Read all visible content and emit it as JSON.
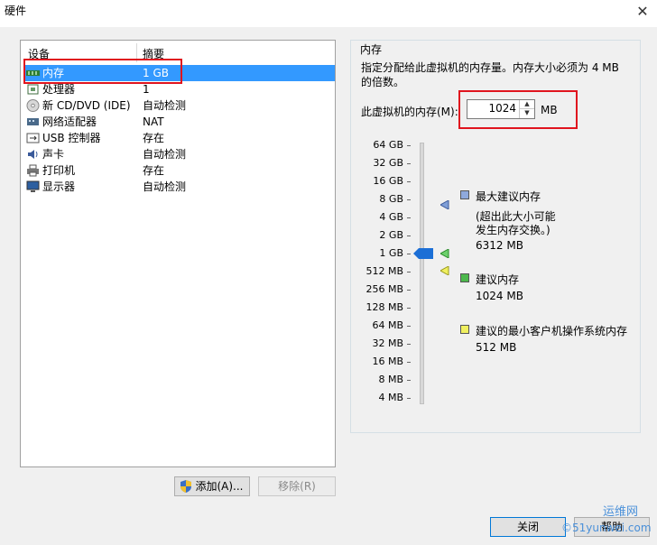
{
  "window": {
    "title": "硬件"
  },
  "devices": {
    "col_device": "设备",
    "col_summary": "摘要",
    "items": [
      {
        "name": "内存",
        "summary": "1 GB",
        "icon": "memory-icon",
        "selected": true
      },
      {
        "name": "处理器",
        "summary": "1",
        "icon": "cpu-icon"
      },
      {
        "name": "新 CD/DVD (IDE)",
        "summary": "自动检测",
        "icon": "cd-icon"
      },
      {
        "name": "网络适配器",
        "summary": "NAT",
        "icon": "network-icon"
      },
      {
        "name": "USB 控制器",
        "summary": "存在",
        "icon": "usb-icon"
      },
      {
        "name": "声卡",
        "summary": "自动检测",
        "icon": "sound-icon"
      },
      {
        "name": "打印机",
        "summary": "存在",
        "icon": "printer-icon"
      },
      {
        "name": "显示器",
        "summary": "自动检测",
        "icon": "monitor-icon"
      }
    ],
    "add_button": "添加(A)...",
    "remove_button": "移除(R)"
  },
  "memory": {
    "group_label": "内存",
    "description_line1": "指定分配给此虚拟机的内存量。内存大小必须为 4 MB",
    "description_line2": "的倍数。",
    "field_label": "此虚拟机的内存(M):",
    "value": "1024",
    "unit": "MB",
    "scale": [
      "64 GB",
      "32 GB",
      "16 GB",
      "8 GB",
      "4 GB",
      "2 GB",
      "1 GB",
      "512 MB",
      "256 MB",
      "128 MB",
      "64 MB",
      "32 MB",
      "16 MB",
      "8 MB",
      "4 MB"
    ],
    "legend": {
      "max_title": "最大建议内存",
      "max_note1": "(超出此大小可能",
      "max_note2": "发生内存交换。)",
      "max_value": "6312 MB",
      "rec_title": "建议内存",
      "rec_value": "1024 MB",
      "min_title": "建议的最小客户机操作系统内存",
      "min_value": "512 MB"
    },
    "colors": {
      "max": "#6b8fd0",
      "rec": "#3cae3c",
      "min": "#e8e84a",
      "selected": "#3399ff"
    }
  },
  "footer": {
    "close_button": "关闭",
    "help_button": "帮助"
  },
  "watermark": {
    "line1": "运维网",
    "line2": "©51yunwei.com"
  }
}
